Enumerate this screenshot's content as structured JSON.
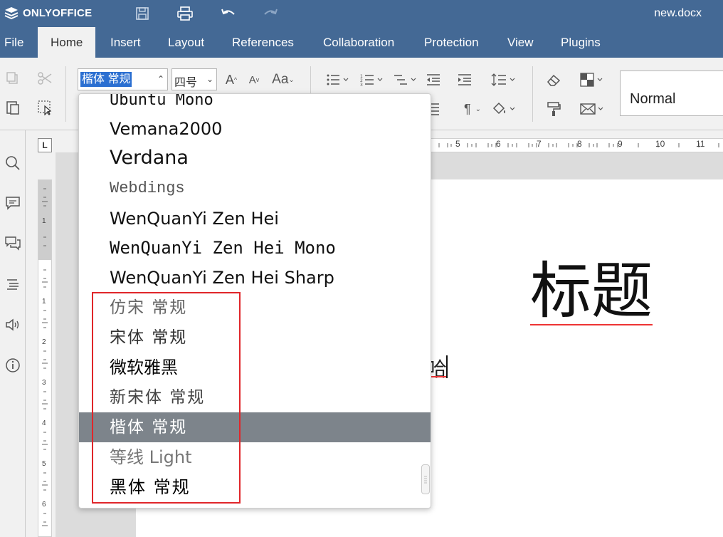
{
  "app": {
    "brand": "ONLYOFFICE",
    "doc_title": "new.docx",
    "title_icons": [
      "save-icon",
      "print-icon",
      "undo-icon",
      "redo-icon"
    ]
  },
  "menu": {
    "tabs": [
      "File",
      "Home",
      "Insert",
      "Layout",
      "References",
      "Collaboration",
      "Protection",
      "View",
      "Plugins"
    ],
    "active": "Home"
  },
  "toolbar": {
    "font_name": "楷体 常规",
    "font_size": "四号",
    "style": "Normal"
  },
  "font_list": {
    "partial_top": "Ubuntu Mono",
    "items": [
      "Vemana2000",
      "Verdana",
      "Webdings",
      "WenQuanYi Zen Hei",
      "WenQuanYi Zen Hei Mono",
      "WenQuanYi Zen Hei Sharp",
      "仿宋 常规",
      "宋体 常规",
      "微软雅黑",
      "新宋体 常规",
      "楷体 常规",
      "等线 Light",
      "黑体 常规"
    ],
    "selected": "楷体 常规"
  },
  "document": {
    "heading": "标题",
    "body_fragment": "哈"
  },
  "ruler": {
    "h_labels": [
      "5",
      "6",
      "7",
      "8",
      "9",
      "10",
      "11"
    ],
    "v_labels": [
      "1",
      "1",
      "2",
      "3",
      "4",
      "5",
      "6"
    ]
  },
  "colors": {
    "brand": "#446995",
    "selection": "#7d848b",
    "highlight": "#e0262a"
  }
}
